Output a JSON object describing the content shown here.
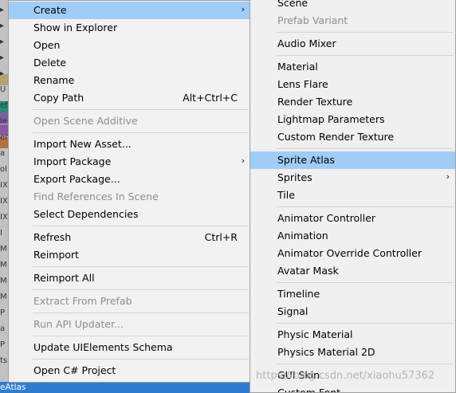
{
  "left_strip": {
    "rows": [
      "▸",
      "▸",
      "▸",
      "▸",
      "▸",
      "U",
      "ef",
      "le",
      "er",
      "a",
      "ol",
      "IX",
      "IX",
      "IX",
      "I",
      "M",
      "M",
      "M",
      "M",
      "P",
      "a",
      "P",
      "ts"
    ],
    "bottom_text": "eAtlas",
    "swatch_colors": [
      "#b8a070",
      "#2a8a78",
      "#7a5fa0",
      "#8a5aa0",
      "#b07040"
    ]
  },
  "main_menu": {
    "items": [
      {
        "label": "Create",
        "submenu": true,
        "highlighted": true
      },
      {
        "label": "Show in Explorer"
      },
      {
        "label": "Open"
      },
      {
        "label": "Delete"
      },
      {
        "label": "Rename"
      },
      {
        "label": "Copy Path",
        "shortcut": "Alt+Ctrl+C"
      },
      {
        "sep": true
      },
      {
        "label": "Open Scene Additive",
        "disabled": true
      },
      {
        "sep": true
      },
      {
        "label": "Import New Asset..."
      },
      {
        "label": "Import Package",
        "submenu": true
      },
      {
        "label": "Export Package..."
      },
      {
        "label": "Find References In Scene",
        "disabled": true
      },
      {
        "label": "Select Dependencies"
      },
      {
        "sep": true
      },
      {
        "label": "Refresh",
        "shortcut": "Ctrl+R"
      },
      {
        "label": "Reimport"
      },
      {
        "sep": true
      },
      {
        "label": "Reimport All"
      },
      {
        "sep": true
      },
      {
        "label": "Extract From Prefab",
        "disabled": true
      },
      {
        "sep": true
      },
      {
        "label": "Run API Updater...",
        "disabled": true
      },
      {
        "sep": true
      },
      {
        "label": "Update UIElements Schema"
      },
      {
        "sep": true
      },
      {
        "label": "Open C# Project"
      }
    ]
  },
  "sub_menu": {
    "items": [
      {
        "label": "Scene"
      },
      {
        "label": "Prefab Variant",
        "disabled": true
      },
      {
        "sep": true
      },
      {
        "label": "Audio Mixer"
      },
      {
        "sep": true
      },
      {
        "label": "Material"
      },
      {
        "label": "Lens Flare"
      },
      {
        "label": "Render Texture"
      },
      {
        "label": "Lightmap Parameters"
      },
      {
        "label": "Custom Render Texture"
      },
      {
        "sep": true
      },
      {
        "label": "Sprite Atlas",
        "highlighted": true
      },
      {
        "label": "Sprites",
        "submenu": true
      },
      {
        "label": "Tile"
      },
      {
        "sep": true
      },
      {
        "label": "Animator Controller"
      },
      {
        "label": "Animation"
      },
      {
        "label": "Animator Override Controller"
      },
      {
        "label": "Avatar Mask"
      },
      {
        "sep": true
      },
      {
        "label": "Timeline"
      },
      {
        "label": "Signal"
      },
      {
        "sep": true
      },
      {
        "label": "Physic Material"
      },
      {
        "label": "Physics Material 2D"
      },
      {
        "sep": true
      },
      {
        "label": "GUI Skin"
      },
      {
        "label": "Custom Font"
      }
    ]
  },
  "watermark": "https://blog.csdn.net/xiaohu57362",
  "icons": {
    "submenu_arrow": "chevron-right-icon"
  }
}
